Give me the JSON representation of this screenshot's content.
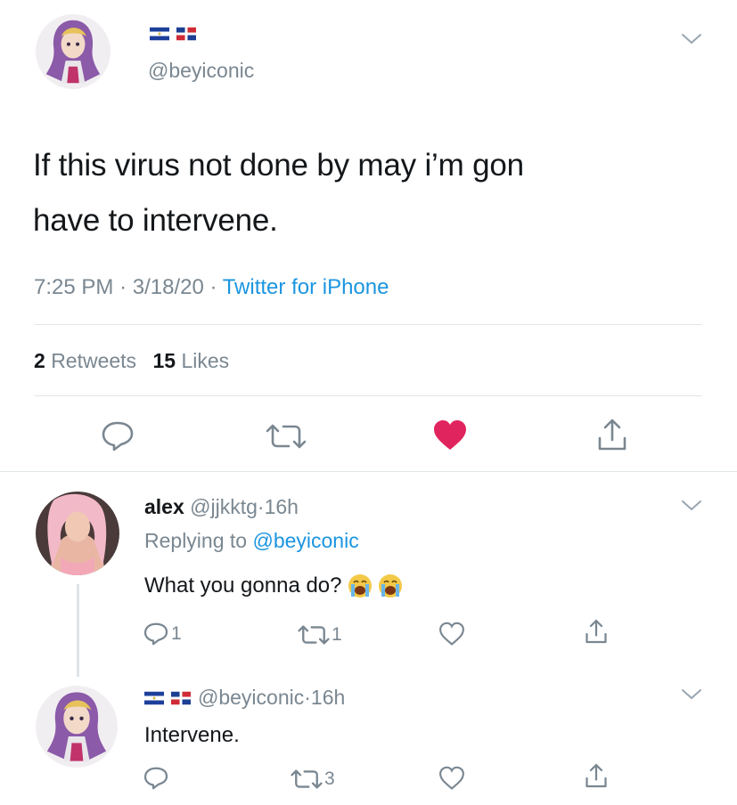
{
  "main_tweet": {
    "handle": "@beyiconic",
    "author_flags": [
      "el-salvador-flag",
      "dominican-republic-flag"
    ],
    "text_line1": "If this virus not done by may i’m gon",
    "text_line2": "have to intervene.",
    "time": "7:25 PM",
    "dot": "·",
    "date": "3/18/20",
    "source": "Twitter for iPhone",
    "retweets_count": "2",
    "retweets_label": "Retweets",
    "likes_count": "15",
    "likes_label": "Likes",
    "liked": true,
    "actions": [
      "reply-icon",
      "retweet-icon",
      "like-icon",
      "share-icon"
    ]
  },
  "reply1": {
    "name": "alex",
    "handle": "@jjkktg",
    "time": "16h",
    "dot": "·",
    "replying_prefix": "Replying to",
    "replying_handle": "@beyiconic",
    "text": "What you gonna do?",
    "emojis": [
      "crying-face-emoji",
      "crying-face-emoji"
    ],
    "reply_count": "1",
    "retweet_count": "1",
    "like_count": "",
    "actions": [
      "reply-icon",
      "retweet-icon",
      "like-icon",
      "share-icon"
    ]
  },
  "reply2": {
    "handle": "@beyiconic",
    "author_flags": [
      "el-salvador-flag",
      "dominican-republic-flag"
    ],
    "time": "16h",
    "dot": "·",
    "text": "Intervene.",
    "reply_count": "",
    "retweet_count": "3",
    "like_count": "",
    "actions": [
      "reply-icon",
      "retweet-icon",
      "like-icon",
      "share-icon"
    ]
  },
  "colors": {
    "accent": "#1b95e0",
    "like": "#e0245e",
    "muted": "#7a8791",
    "text": "#14171a"
  }
}
